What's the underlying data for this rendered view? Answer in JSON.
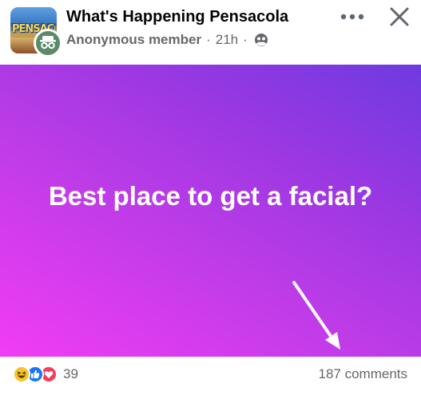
{
  "header": {
    "group_name": "What's Happening Pensacola",
    "group_avatar_text": "PENSACOLA",
    "author": "Anonymous member",
    "separator": "·",
    "time": "21h",
    "privacy_icon": "group-icon",
    "more_icon": "more-horizontal-icon",
    "close_icon": "close-icon"
  },
  "post": {
    "text": "Best place to get a facial?",
    "background_gradient": [
      "#f23cf4",
      "#9a38e2",
      "#6e3ae0"
    ],
    "annotation_icon": "arrow-icon"
  },
  "footer": {
    "reaction_icons": [
      "haha-icon",
      "like-icon",
      "love-icon"
    ],
    "reaction_count": "39",
    "comments": "187 comments"
  },
  "colors": {
    "text_primary": "#050505",
    "text_secondary": "#65676b",
    "like_blue": "#1877f2",
    "love_red": "#f33e58",
    "haha_yellow": "#f7c52b"
  }
}
